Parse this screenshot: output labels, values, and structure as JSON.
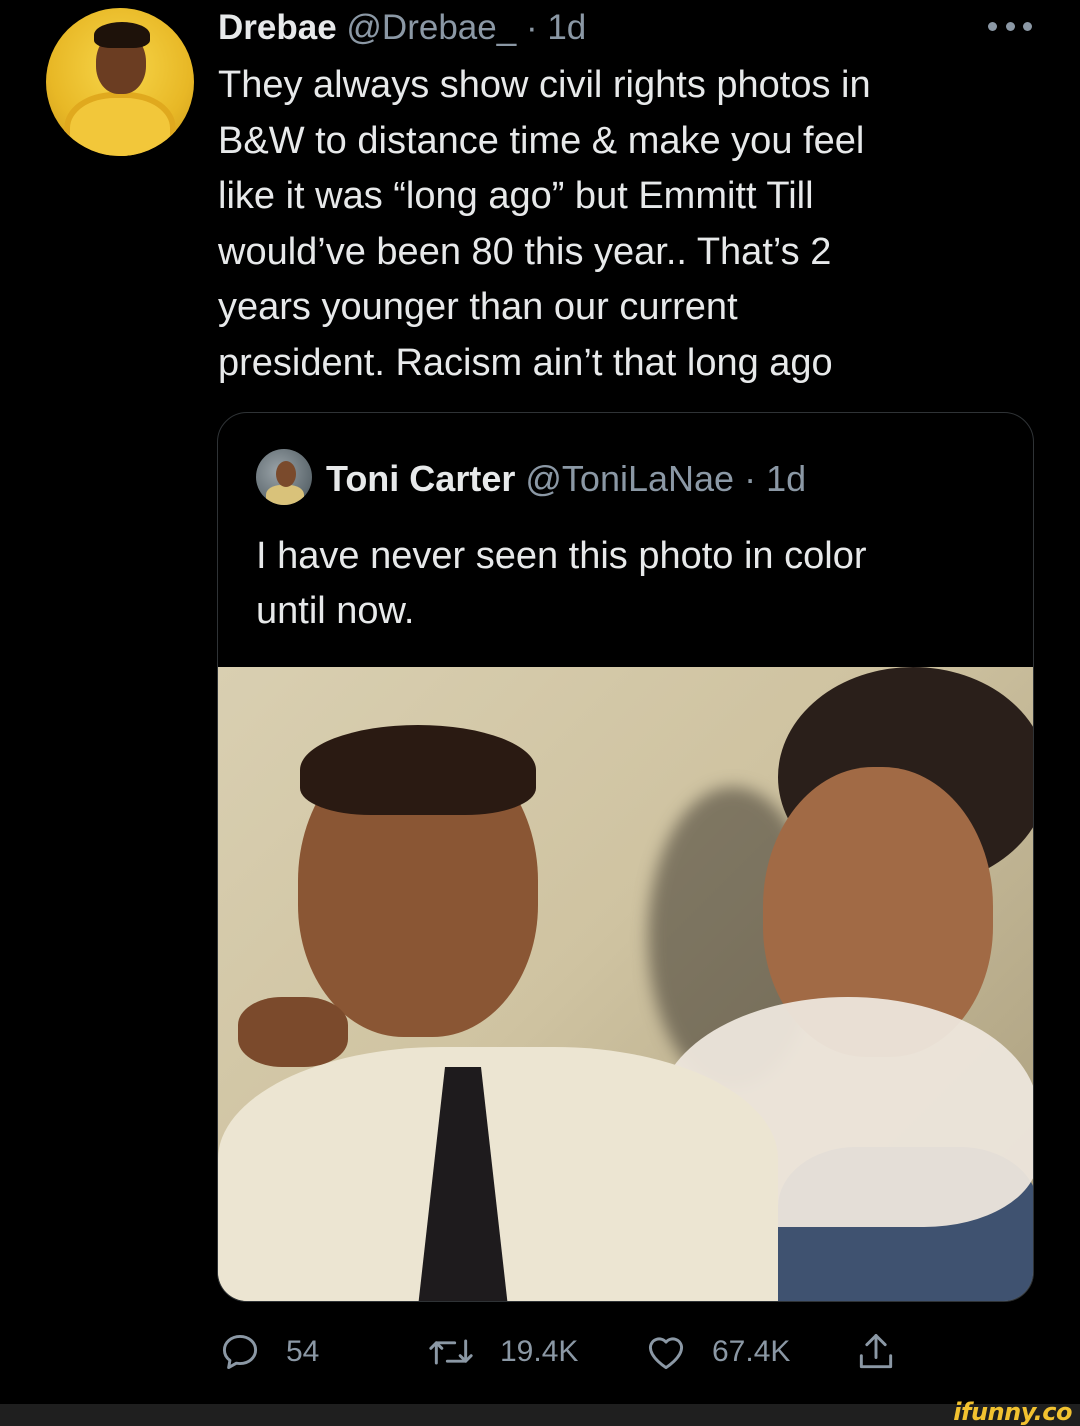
{
  "tweet": {
    "author_name": "Drebae",
    "author_handle": "@Drebae_",
    "separator": "·",
    "time": "1d",
    "lines": [
      "They always show civil rights photos in",
      "B&W to distance time & make you feel",
      "like it was “long ago” but Emmitt Till",
      "would’ve been 80 this year.. That’s 2",
      "years younger than our current",
      "president. Racism ain’t that long ago"
    ]
  },
  "quoted": {
    "author_name": "Toni Carter",
    "author_handle": "@ToniLaNae",
    "separator": "·",
    "time": "1d",
    "lines": [
      "I have never seen this photo in color",
      "until now."
    ]
  },
  "actions": {
    "replies": "54",
    "retweets": "19.4K",
    "likes": "67.4K"
  },
  "icons": {
    "more": "more-dots-icon",
    "reply": "reply-bubble-icon",
    "retweet": "retweet-arrows-icon",
    "like": "heart-icon",
    "share": "share-upload-icon"
  },
  "watermark": "ifunny.co",
  "colors": {
    "background": "#000000",
    "text": "#e7e9ea",
    "muted": "#8b98a5",
    "border": "#2f3336",
    "watermark": "#f2c230"
  }
}
